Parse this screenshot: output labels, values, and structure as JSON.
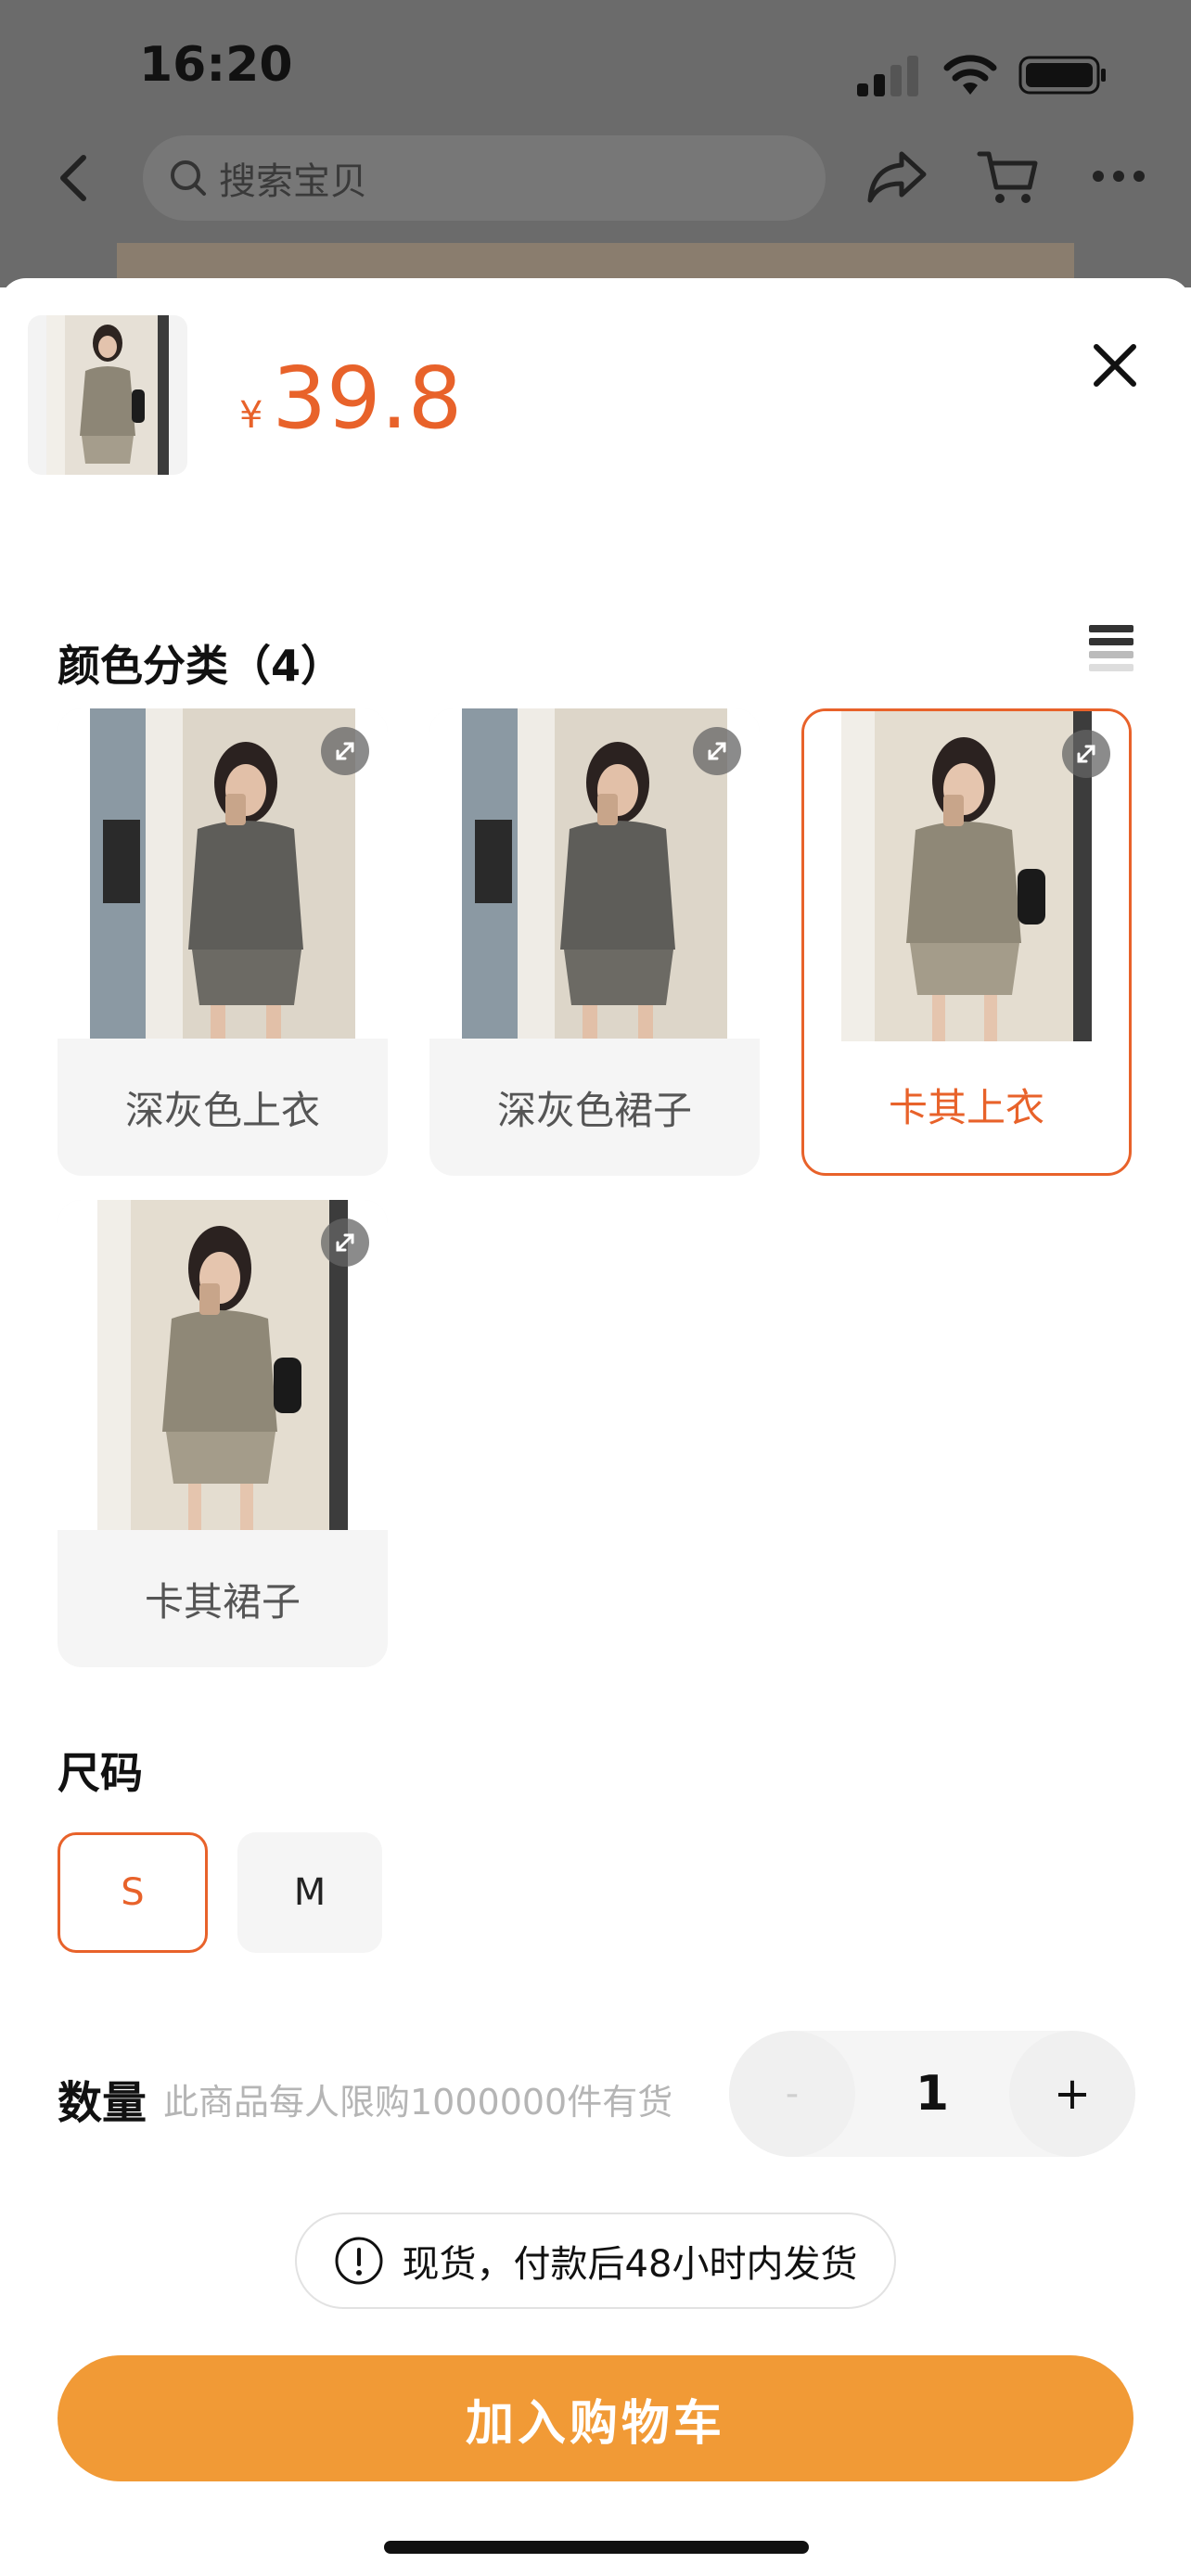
{
  "status_bar": {
    "time": "16:20"
  },
  "top_bar": {
    "search_placeholder": "搜索宝贝"
  },
  "product": {
    "currency": "¥",
    "price": "39.8"
  },
  "color_section": {
    "title": "颜色分类（4）",
    "options": [
      {
        "label": "深灰色上衣",
        "selected": false
      },
      {
        "label": "深灰色裙子",
        "selected": false
      },
      {
        "label": "卡其上衣",
        "selected": true
      },
      {
        "label": "卡其裙子",
        "selected": false
      }
    ]
  },
  "size_section": {
    "title": "尺码",
    "options": [
      {
        "label": "S",
        "selected": true
      },
      {
        "label": "M",
        "selected": false
      }
    ]
  },
  "quantity": {
    "label": "数量",
    "note": "此商品每人限购1000000件有货",
    "minus": "-",
    "value": "1",
    "plus": "+"
  },
  "notice": {
    "text": "现货，付款后48小时内发货"
  },
  "cta": {
    "label": "加入购物车"
  },
  "colors": {
    "accent": "#e8622a",
    "cta": "#f19a36"
  }
}
